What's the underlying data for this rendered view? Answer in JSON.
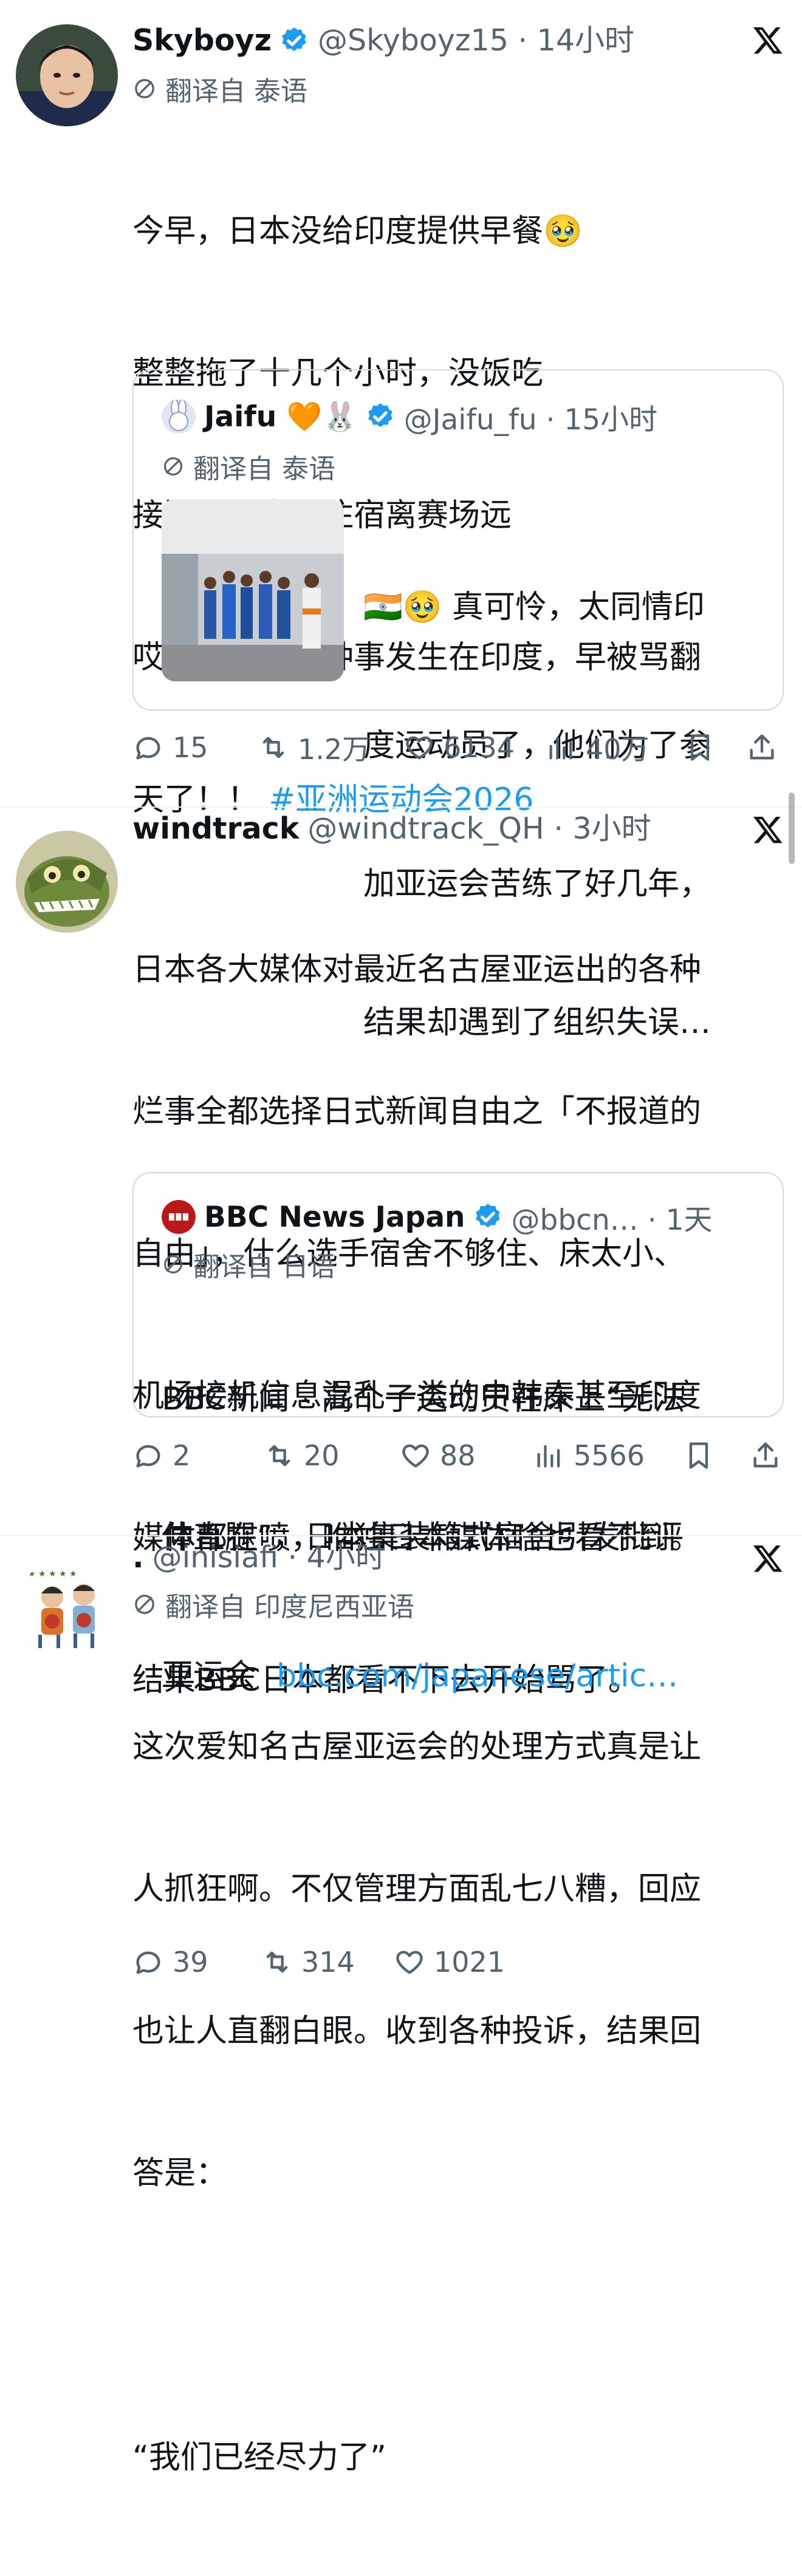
{
  "colors": {
    "link": "#1d9bf0",
    "secondary": "#536471",
    "border": "#cfd9de"
  },
  "tweets": [
    {
      "name": "Skyboyz",
      "handle": "@Skyboyz15 · 14小时",
      "translated_from": "翻译自 泰语",
      "lines": [
        "今早，日本没给印度提供早餐🥹",
        "整整拖了十几个小时，没饭吃",
        "接送车晚点，住宿离赛场远",
        "哎呀，要是这种事发生在印度，早被骂翻"
      ],
      "last_line_text": "天了！！ ",
      "hashtag": "#亚洲运动会2026",
      "quote": {
        "name": "Jaifu 🧡🐰",
        "handle": "@Jaifu_fu · 15小时",
        "translated_from": "翻译自 泰语",
        "lines": [
          "🇮🇳🥹 真可怜，太同情印",
          "度运动员了，他们为了参",
          "加亚运会苦练了好几年，",
          "结果却遇到了组织失误…"
        ]
      },
      "stats": {
        "replies": "15",
        "retweets": "1.2万",
        "likes": "6134",
        "views": "40万"
      }
    },
    {
      "name": "windtrack",
      "handle": "@windtrack_QH · 3小时",
      "lines": [
        "日本各大媒体对最近名古屋亚运出的各种",
        "烂事全都选择日式新闻自由之「不报道的",
        "自由」，什么选手宿舍不够住、床太小、",
        "机场接机信息混乱一类的中韩泰甚至印度",
        "媒体都在喷，唯独日本媒体啥也看不到。",
        "结果BBC日本都看不下去开始骂了。"
      ],
      "quote": {
        "name": "BBC News Japan",
        "handle": "@bbcn… · 1天",
        "translated_from": "翻译自 日语",
        "lines": [
          "BBC新闻 - 高个子运动员在床上“无法",
          "伸直腿”，日本集装箱式宿舍引发批评"
        ],
        "last_line_text": "亚运会  ",
        "link": "bbc.com/japanese/artic…"
      },
      "stats": {
        "replies": "2",
        "retweets": "20",
        "likes": "88",
        "views": "5566"
      }
    },
    {
      "name": ".",
      "handle": "@inisiafi · 4小时",
      "translated_from": "翻译自 印度尼西亚语",
      "lines": [
        "这次爱知名古屋亚运会的处理方式真是让",
        "人抓狂啊。不仅管理方面乱七八糟，回应",
        "也让人直翻白眼。收到各种投诉，结果回",
        "答是：",
        "",
        "“我们已经尽力了”"
      ],
      "stats": {
        "replies": "39",
        "retweets": "314",
        "likes": "1021"
      }
    }
  ]
}
